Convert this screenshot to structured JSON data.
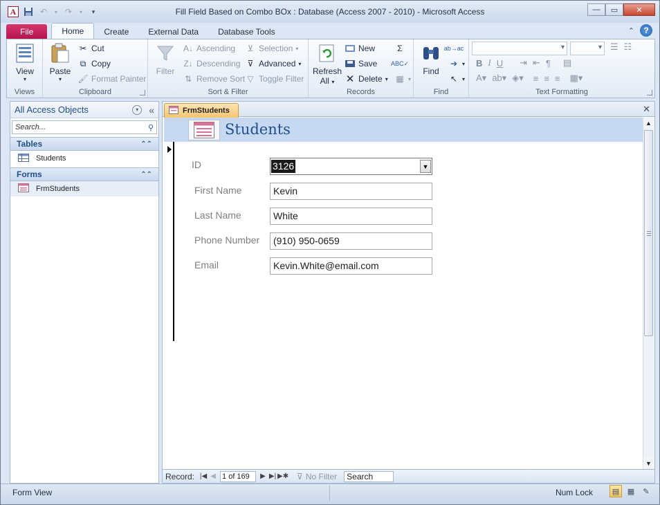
{
  "window": {
    "title": "Fill Field Based on Combo BOx : Database (Access 2007 - 2010)  -  Microsoft Access",
    "app_icon_letter": "A"
  },
  "ribbon_tabs": [
    "File",
    "Home",
    "Create",
    "External Data",
    "Database Tools"
  ],
  "ribbon": {
    "views": {
      "label": "Views",
      "view_button": "View"
    },
    "clipboard": {
      "label": "Clipboard",
      "paste": "Paste",
      "cut": "Cut",
      "copy": "Copy",
      "format_painter": "Format Painter"
    },
    "sort_filter": {
      "label": "Sort & Filter",
      "filter": "Filter",
      "ascending": "Ascending",
      "descending": "Descending",
      "remove_sort": "Remove Sort",
      "selection": "Selection",
      "advanced": "Advanced",
      "toggle_filter": "Toggle Filter"
    },
    "records": {
      "label": "Records",
      "refresh_all_1": "Refresh",
      "refresh_all_2": "All",
      "new": "New",
      "save": "Save",
      "delete": "Delete"
    },
    "find": {
      "label": "Find",
      "find_button": "Find"
    },
    "text_formatting": {
      "label": "Text Formatting"
    }
  },
  "nav_pane": {
    "title": "All Access Objects",
    "search_placeholder": "Search...",
    "groups": [
      {
        "name": "Tables",
        "items": [
          "Students"
        ]
      },
      {
        "name": "Forms",
        "items": [
          "FrmStudents"
        ]
      }
    ]
  },
  "document": {
    "tab_label": "FrmStudents",
    "form_title": "Students",
    "fields": {
      "id": {
        "label": "ID",
        "value": "3126"
      },
      "first_name": {
        "label": "First Name",
        "value": "Kevin"
      },
      "last_name": {
        "label": "Last Name",
        "value": "White"
      },
      "phone": {
        "label": "Phone Number",
        "value": "(910) 950-0659"
      },
      "email": {
        "label": "Email",
        "value": "Kevin.White@email.com"
      }
    }
  },
  "record_nav": {
    "label": "Record:",
    "current": "1 of 169",
    "filter_status": "No Filter",
    "search_label": "Search"
  },
  "status_bar": {
    "left": "Form View",
    "right": "Num Lock"
  },
  "colors": {
    "file_tab": "#b3134c",
    "form_header": "#c6d9f1",
    "accent_text": "#1f4e8c",
    "doc_tab": "#f8c56e"
  }
}
